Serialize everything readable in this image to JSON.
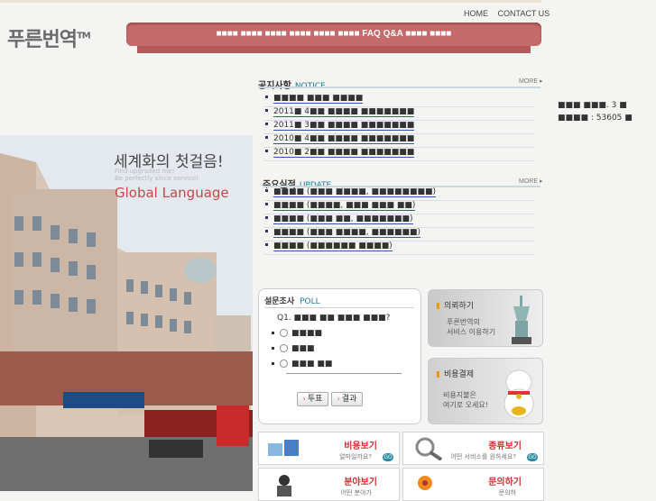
{
  "header": {
    "logo": "푸른번역",
    "logo_tm": "TM",
    "links": [
      "HOME",
      "CONTACT US"
    ],
    "nav_text": "■■■■ ■■■■ ■■■■ ■■■■ ■■■■ ■■■■ FAQ Q&A ■■■■ ■■■■"
  },
  "hero": {
    "title_ko": "세계화의 첫걸음!",
    "line1": "Find upgraded me!",
    "line2": "Be perfectly since service!",
    "title_en": "Global Language"
  },
  "notice": {
    "title": "공지사항",
    "title_en": "NOTICE",
    "more": "MORE",
    "items": [
      "■■■■ ■■■ ■■■■",
      "2011■ 4■■ ■■■■ ■■■■■■■",
      "2011■ 3■■ ■■■■ ■■■■■■■",
      "2010■ 4■■ ■■■■ ■■■■■■■",
      "2010■ 2■■ ■■■■ ■■■■■■■"
    ]
  },
  "update": {
    "title": "주요실적",
    "title_en": "UPDATE",
    "more": "MORE",
    "items": [
      "■■■■ (■■■ ■■■■, ■■■■■■■■)",
      "■■■■ (■■■■, ■■■ ■■■ ■■)",
      "■■■■ (■■■ ■■, ■■■■■■■)",
      "■■■■ (■■■ ■■■■, ■■■■■■)",
      "■■■■ (■■■■■■ ■■■■)"
    ]
  },
  "stats": {
    "line1": "■■■ ■■■. 3 ■",
    "line2": "■■■■ : 53605 ■"
  },
  "poll": {
    "title": "설문조사",
    "title_en": "POLL",
    "question": "Q1. ■■■ ■■ ■■■ ■■■?",
    "options": [
      "■■■■",
      "■■■",
      "■■■ ■■"
    ],
    "vote_label": "투표",
    "result_label": "결과"
  },
  "cards": {
    "request": {
      "title": "의뢰하기",
      "sub1": "푸른번역의",
      "sub2": "서비스 이용하기"
    },
    "payment": {
      "title": "비용결제",
      "sub1": "비용지불은",
      "sub2": "여기로 오세요!"
    }
  },
  "tiles": [
    {
      "title": "비용보기",
      "sub": "얼마일까요?"
    },
    {
      "title": "종류보기",
      "sub": "어떤 서비스를 원하세요?"
    },
    {
      "title": "분야보기",
      "sub": "어떤 분야가"
    },
    {
      "title": "문의하기",
      "sub": "문의하"
    }
  ],
  "colors": {
    "nav": "#c46a6a",
    "accent_red": "#c24a4a",
    "accent_blue": "#1b7d9c"
  }
}
